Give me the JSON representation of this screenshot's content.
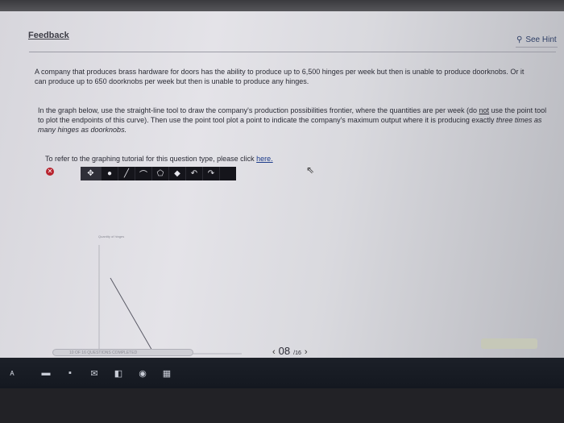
{
  "header": {
    "feedback_label": "Feedback",
    "hint_label": "See Hint"
  },
  "question": {
    "paragraph1": "A company that produces brass hardware for doors has the ability to produce up to 6,500 hinges per week but then is unable to produce doorknobs. Or it can produce up to 650 doorknobs per week but then is unable to produce any hinges.",
    "p2_part1": "In the graph below, use the straight-line tool to draw the company's production possibilities frontier, where the quantities are per week (do ",
    "p2_not": "not",
    "p2_part2": " use the point tool to plot the endpoints of this curve). Then use the point tool plot a point to indicate the company's maximum output where it is producing exactly ",
    "p2_italic": "three times as many hinges as doorknobs.",
    "tutorial_text": "To refer to the graphing tutorial for this question type, please click ",
    "tutorial_link": "here."
  },
  "graph": {
    "y_axis_label": "Quantity of hinges"
  },
  "footer": {
    "progress_text": "10 OF 16 QUESTIONS COMPLETED",
    "current_page": "08",
    "total_pages": "/16"
  },
  "icons": {
    "close": "x-icon",
    "hint": "lightbulb-icon"
  },
  "colors": {
    "toolbar_bg": "#15151b",
    "close_red": "#b8232e",
    "link_blue": "#1c3b8a"
  }
}
